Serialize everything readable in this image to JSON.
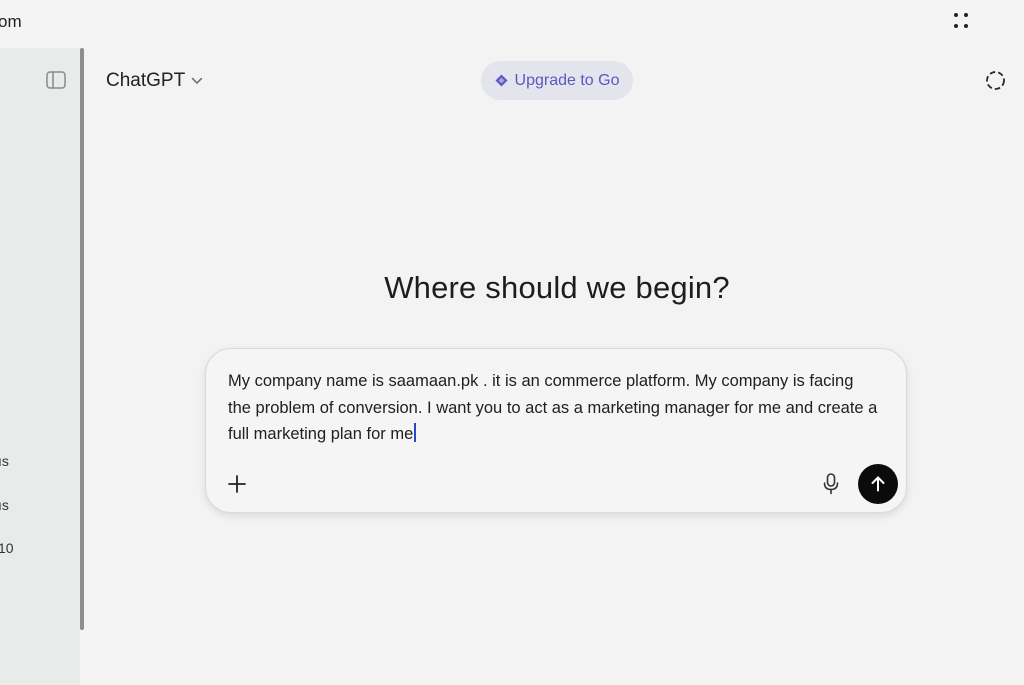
{
  "browser": {
    "url_fragment": "om"
  },
  "sidebar": {
    "fragments": [
      "ıs",
      "ıs",
      "10"
    ]
  },
  "header": {
    "model_name": "ChatGPT",
    "upgrade_label": "Upgrade to Go"
  },
  "main": {
    "headline": "Where should we begin?"
  },
  "composer": {
    "text": "My company name is saamaan.pk . it is an commerce platform. My company is facing the problem of conversion. I want you to act as a marketing manager for me and create a full marketing plan for me"
  },
  "colors": {
    "accent": "#5b58c2",
    "send_button": "#0b0b0b"
  },
  "icons": {
    "apps": "dots-grid-icon",
    "sidebar": "sidebar-toggle-icon",
    "upgrade": "diamond-icon",
    "temporary": "temporary-chat-icon",
    "add": "plus-icon",
    "voice": "microphone-icon",
    "send": "arrow-up-icon"
  }
}
